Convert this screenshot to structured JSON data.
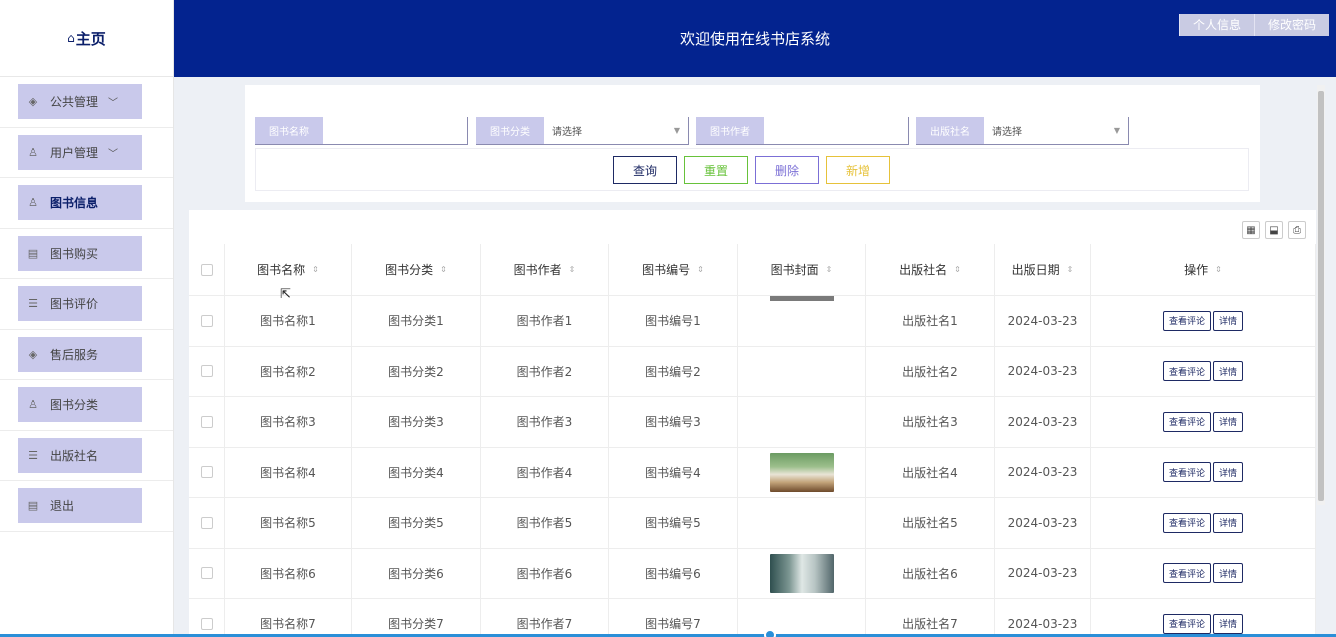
{
  "sidebar": {
    "home_label": "主页",
    "items": [
      {
        "label": "公共管理",
        "icon": "layers-icon",
        "has_chevron": true,
        "active": false
      },
      {
        "label": "用户管理",
        "icon": "user-icon",
        "has_chevron": true,
        "active": false
      },
      {
        "label": "图书信息",
        "icon": "book-icon",
        "has_chevron": false,
        "active": true
      },
      {
        "label": "图书购买",
        "icon": "cart-icon",
        "has_chevron": false,
        "active": false
      },
      {
        "label": "图书评价",
        "icon": "comment-icon",
        "has_chevron": false,
        "active": false
      },
      {
        "label": "售后服务",
        "icon": "layers-icon",
        "has_chevron": false,
        "active": false
      },
      {
        "label": "图书分类",
        "icon": "user-icon",
        "has_chevron": false,
        "active": false
      },
      {
        "label": "出版社名",
        "icon": "comment-icon",
        "has_chevron": false,
        "active": false
      },
      {
        "label": "退出",
        "icon": "cart-icon",
        "has_chevron": false,
        "active": false
      }
    ]
  },
  "header": {
    "title": "欢迎使用在线书店系统",
    "profile_label": "个人信息",
    "password_label": "修改密码"
  },
  "search": {
    "name_label": "图书名称",
    "name_value": "",
    "category_label": "图书分类",
    "category_placeholder": "请选择",
    "author_label": "图书作者",
    "author_value": "",
    "publisher_label": "出版社名",
    "publisher_placeholder": "请选择"
  },
  "actions": {
    "query": "查询",
    "reset": "重置",
    "delete": "删除",
    "add": "新增",
    "query_color": "#1e2a64",
    "reset_color": "#67c23a",
    "delete_color": "#7b6fd6",
    "add_color": "#e6c23a"
  },
  "table": {
    "columns": [
      "图书名称",
      "图书分类",
      "图书作者",
      "图书编号",
      "图书封面",
      "出版社名",
      "出版日期",
      "操作"
    ],
    "view_comments_label": "查看评论",
    "detail_label": "详情",
    "rows": [
      {
        "name": "图书名称1",
        "category": "图书分类1",
        "author": "图书作者1",
        "code": "图书编号1",
        "cover": "partial",
        "publisher": "出版社名1",
        "date": "2024-03-23"
      },
      {
        "name": "图书名称2",
        "category": "图书分类2",
        "author": "图书作者2",
        "code": "图书编号2",
        "cover": "",
        "publisher": "出版社名2",
        "date": "2024-03-23"
      },
      {
        "name": "图书名称3",
        "category": "图书分类3",
        "author": "图书作者3",
        "code": "图书编号3",
        "cover": "",
        "publisher": "出版社名3",
        "date": "2024-03-23"
      },
      {
        "name": "图书名称4",
        "category": "图书分类4",
        "author": "图书作者4",
        "code": "图书编号4",
        "cover": "open-book",
        "publisher": "出版社名4",
        "date": "2024-03-23"
      },
      {
        "name": "图书名称5",
        "category": "图书分类5",
        "author": "图书作者5",
        "code": "图书编号5",
        "cover": "",
        "publisher": "出版社名5",
        "date": "2024-03-23"
      },
      {
        "name": "图书名称6",
        "category": "图书分类6",
        "author": "图书作者6",
        "code": "图书编号6",
        "cover": "book-box",
        "publisher": "出版社名6",
        "date": "2024-03-23"
      },
      {
        "name": "图书名称7",
        "category": "图书分类7",
        "author": "图书作者7",
        "code": "图书编号7",
        "cover": "",
        "publisher": "出版社名7",
        "date": "2024-03-23"
      }
    ]
  },
  "colors": {
    "header_bg": "#03238f",
    "menu_bg": "#c9c9eb",
    "accent": "#1e2a64"
  }
}
